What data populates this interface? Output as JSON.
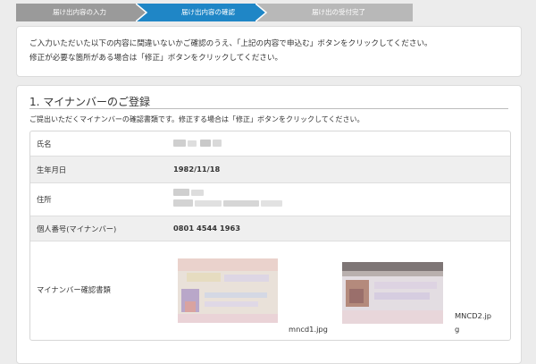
{
  "steps": [
    {
      "label": "届け出内容の入力",
      "state": "done"
    },
    {
      "label": "届け出内容の確認",
      "state": "current"
    },
    {
      "label": "届け出の受付完了",
      "state": "todo"
    }
  ],
  "notice": {
    "line1": "ご入力いただいた以下の内容に間違いないかご確認のうえ、「上記の内容で申込む」ボタンをクリックしてください。",
    "line2": "修正が必要な箇所がある場合は「修正」ボタンをクリックしてください。"
  },
  "section": {
    "title": "1. マイナンバーのご登録",
    "description": "ご提出いただくマイナンバーの確認書類です。修正する場合は「修正」ボタンをクリックしてください。",
    "rows": {
      "name": {
        "label": "氏名"
      },
      "birth": {
        "label": "生年月日",
        "value": "1982/11/18"
      },
      "address": {
        "label": "住所"
      },
      "number": {
        "label": "個人番号(マイナンバー)",
        "value": "0801  4544  1963"
      },
      "docs": {
        "label": "マイナンバー確認書類",
        "files": [
          {
            "name": "mncd1.jpg"
          },
          {
            "name": "MNCD2.jpg"
          }
        ]
      }
    }
  },
  "colors": {
    "step_done": "#9a9a9a",
    "step_current": "#1f86c6",
    "step_todo": "#b8b8b8"
  }
}
